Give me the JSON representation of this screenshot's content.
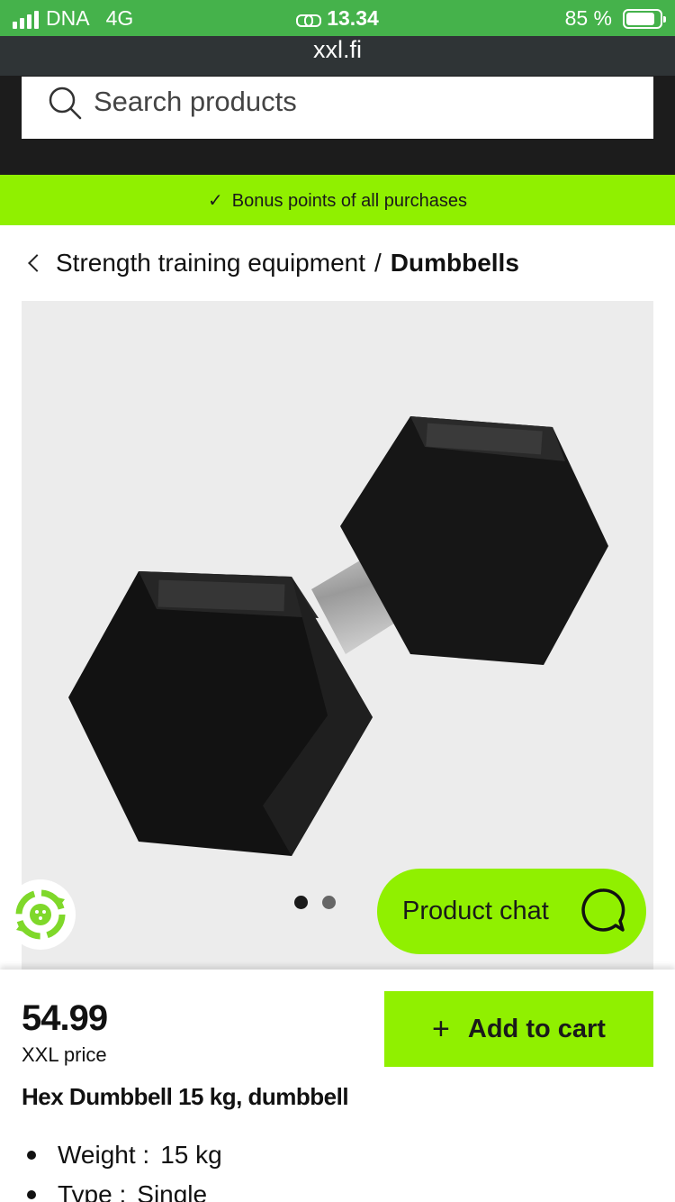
{
  "status_bar": {
    "carrier": "DNA",
    "network": "4G",
    "time": "13.34",
    "battery_text": "85 %",
    "battery_level": 0.85
  },
  "browser": {
    "url": "xxl.fi"
  },
  "search": {
    "placeholder": "Search products"
  },
  "bonus_banner": {
    "text": "Bonus points of all purchases"
  },
  "breadcrumb": {
    "parent": "Strength training equipment",
    "separator": "/",
    "current": "Dumbbells"
  },
  "gallery": {
    "image_count": 2,
    "active_index": 0
  },
  "chat": {
    "label": "Product chat"
  },
  "product": {
    "price": "54.99",
    "price_label": "XXL price",
    "add_to_cart": "Add to cart",
    "title": "Hex Dumbbell 15 kg, dumbbell",
    "specs": [
      {
        "name": "Weight :",
        "value": "15 kg"
      },
      {
        "name": "Type :",
        "value": "Single"
      }
    ]
  },
  "colors": {
    "status_green": "#45b24b",
    "accent_lime": "#90f000",
    "header_dark": "#1c1c1c"
  }
}
